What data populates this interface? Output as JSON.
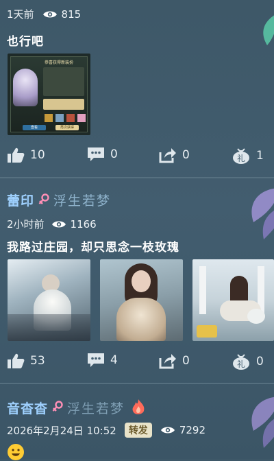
{
  "post1": {
    "time": "1天前",
    "views": "815",
    "title": "也行吧",
    "thumb_text": {
      "heading": "恭喜获得新装扮",
      "btn_left": "查看",
      "btn_right": "再次获得"
    },
    "likes": "10",
    "comments": "0",
    "shares": "0",
    "gifts": "1"
  },
  "post2": {
    "username": "蕾印",
    "guild": "浮生若梦",
    "time": "2小时前",
    "views": "1166",
    "title": "我路过庄园，却只思念一枝玫瑰",
    "likes": "53",
    "comments": "4",
    "shares": "0",
    "gifts": "0"
  },
  "post3": {
    "username": "音杳杳",
    "guild": "浮生若梦",
    "time": "2026年2月24日 10:52",
    "badge": "转发",
    "views": "7292"
  },
  "icons": {
    "gift_char": "礼",
    "gender": "female-icon",
    "emoji": "smile-emoji-icon"
  },
  "colors": {
    "background": "#425d6f",
    "username": "#9fd1ff",
    "gender": "#ff8fb6",
    "accent_fire": "#ff6b5a"
  }
}
